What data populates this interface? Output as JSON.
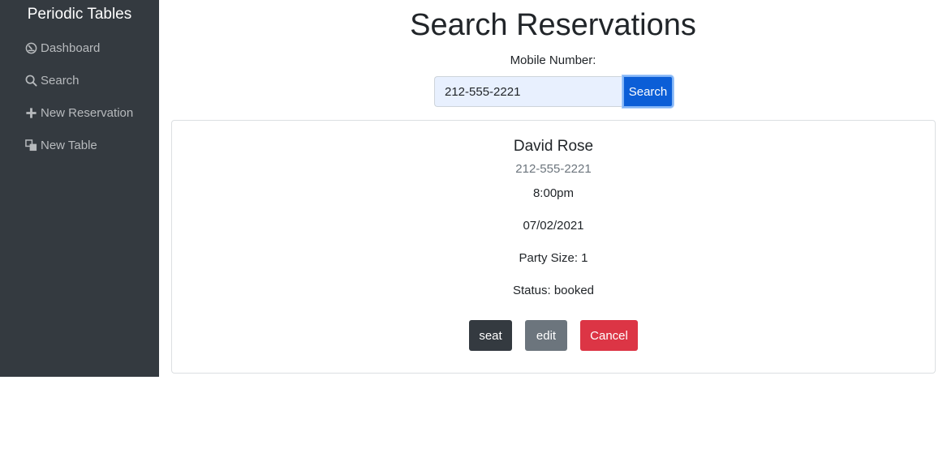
{
  "sidebar": {
    "brand": "Periodic Tables",
    "items": [
      {
        "label": "Dashboard",
        "icon": "dashboard-icon"
      },
      {
        "label": "Search",
        "icon": "search-icon"
      },
      {
        "label": "New Reservation",
        "icon": "plus-icon"
      },
      {
        "label": "New Table",
        "icon": "new-table-icon"
      }
    ]
  },
  "page": {
    "title": "Search Reservations"
  },
  "search": {
    "label": "Mobile Number:",
    "value": "212-555-2221",
    "button_label": "Search"
  },
  "reservation": {
    "name": "David Rose",
    "phone": "212-555-2221",
    "time": "8:00pm",
    "date": "07/02/2021",
    "party_size": "Party Size: 1",
    "status": "Status: booked",
    "actions": {
      "seat": "seat",
      "edit": "edit",
      "cancel": "Cancel"
    }
  },
  "colors": {
    "sidebar_bg": "#343a40",
    "primary": "#0b5ed7",
    "secondary": "#6c757d",
    "danger": "#dc3545"
  }
}
